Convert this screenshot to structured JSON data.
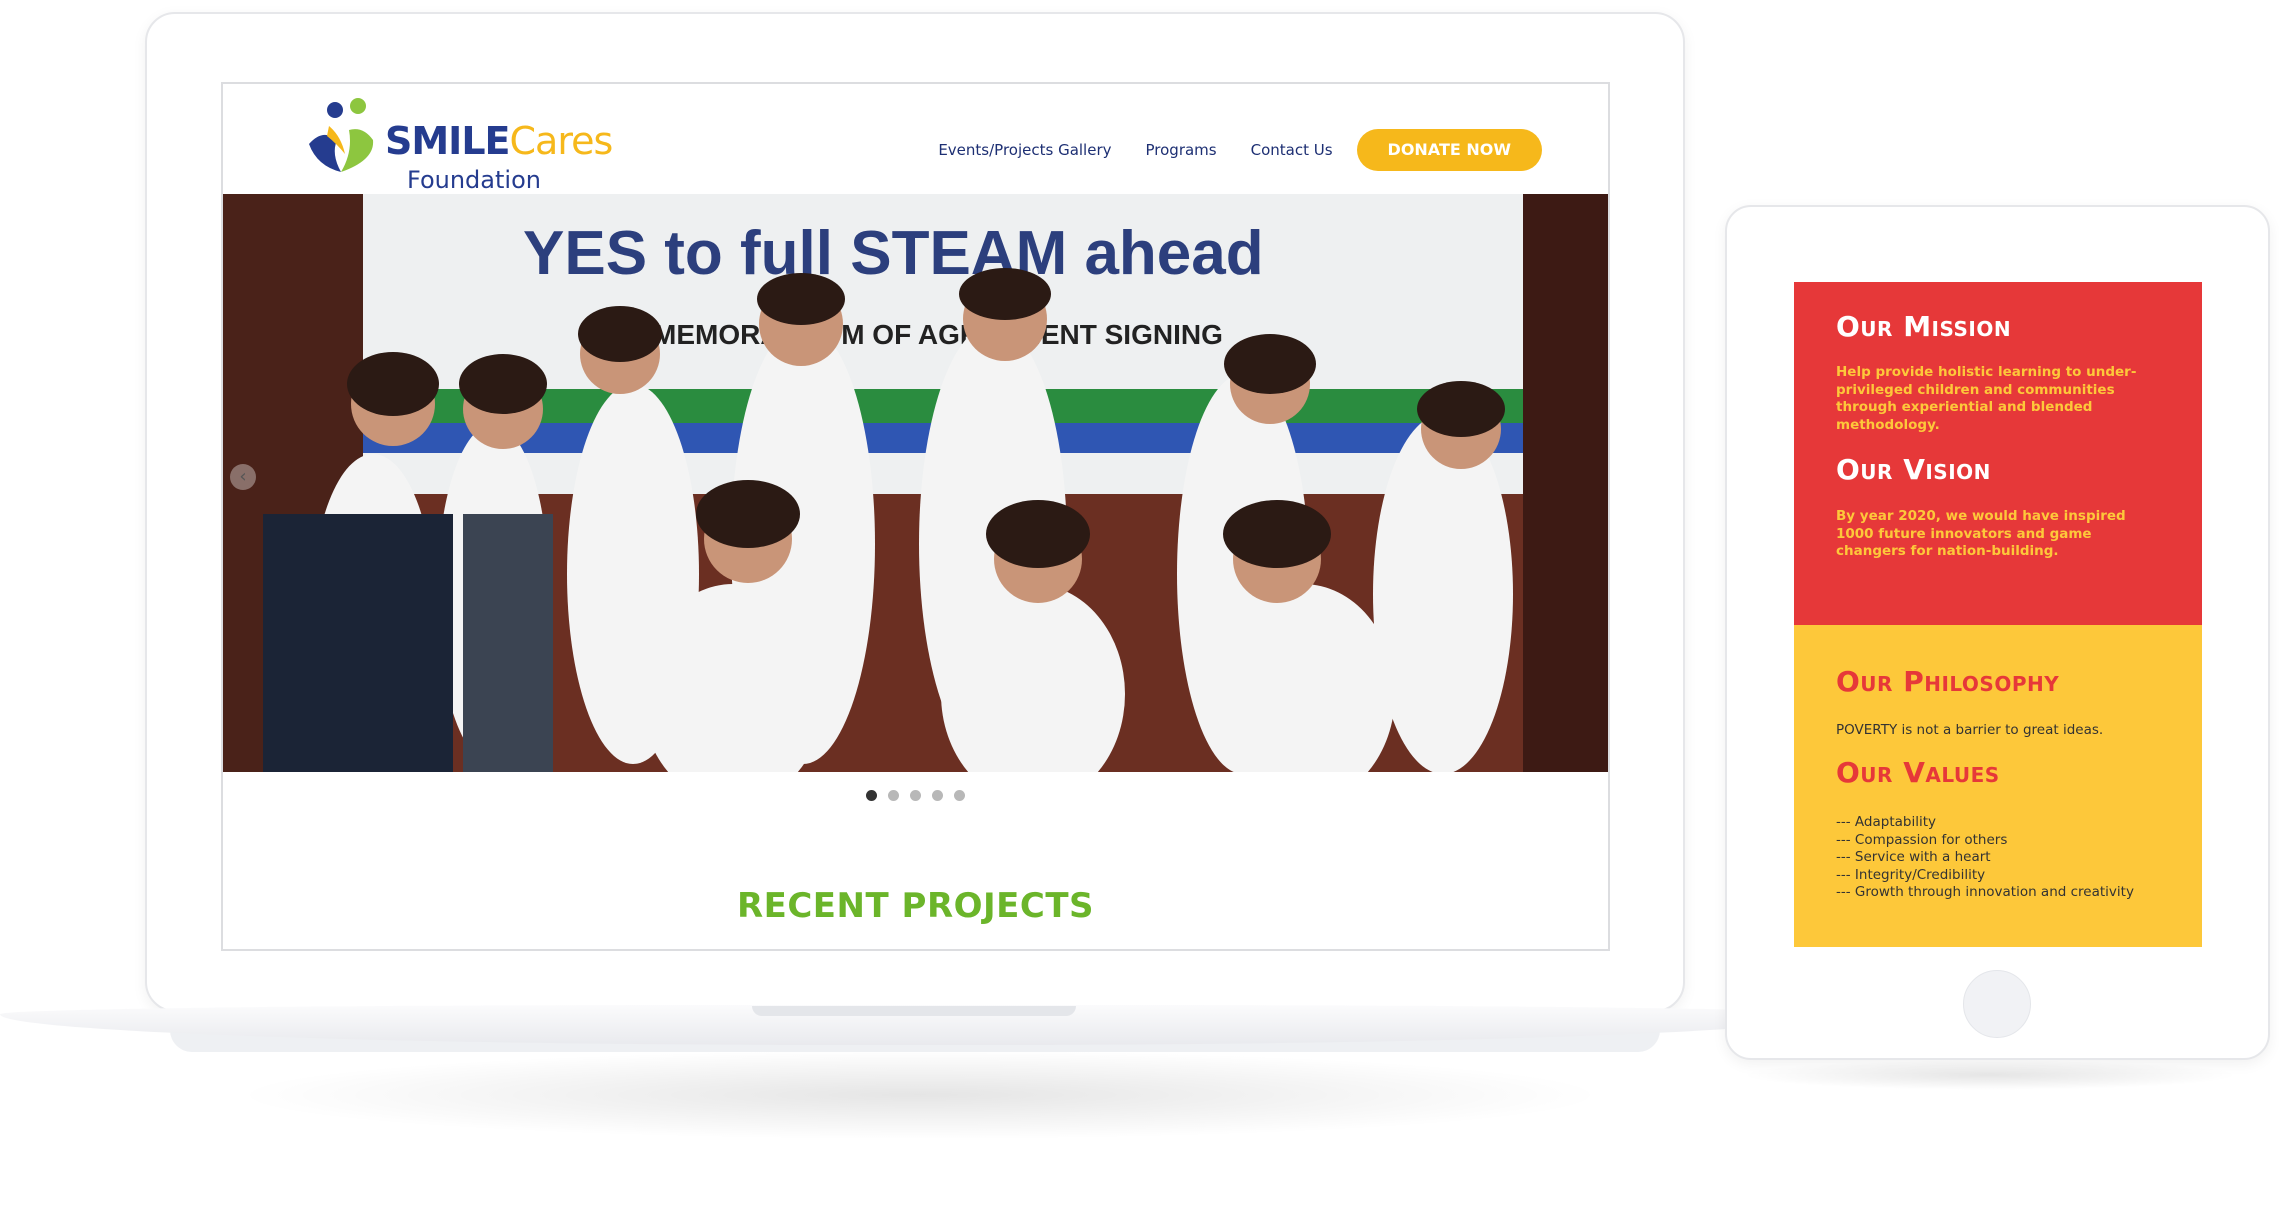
{
  "laptop": {
    "logo": {
      "brand_1": "SMILE",
      "brand_2": "Cares",
      "brand_3": "Foundation"
    },
    "nav": {
      "items": [
        "Events/Projects Gallery",
        "Programs",
        "Contact Us"
      ],
      "cta": "DONATE NOW"
    },
    "hero": {
      "banner_line_1": "YES to full STEAM ahead",
      "banner_line_2": "MEMORANDUM OF AGREEMENT SIGNING",
      "slider_count": 5,
      "active_slide": 1
    },
    "recent_projects_heading": "RECENT PROJECTS"
  },
  "tablet": {
    "mission": {
      "title": "Our Mission",
      "text": "Help provide holistic learning to under-privileged children and communities through experiential and blended methodology."
    },
    "vision": {
      "title": "Our Vision",
      "text": "By year 2020, we would have inspired 1000 future innovators and game changers for nation-building."
    },
    "philosophy": {
      "title": "Our Philosophy",
      "text": "POVERTY is not a barrier to great ideas."
    },
    "values": {
      "title": "Our Values",
      "items": [
        "--- Adaptability",
        "--- Compassion for others",
        "--- Service with a heart",
        "--- Integrity/Credibility",
        "--- Growth through innovation and creativity"
      ]
    }
  },
  "colors": {
    "navy": "#253c8f",
    "yellow": "#f6b81b",
    "green": "#6bb52a",
    "red_panel": "#e63839",
    "yellow_panel": "#fdc83a"
  },
  "icons": [
    "logo-heart-icon",
    "chevron-left-icon",
    "slider-dot-icon"
  ]
}
